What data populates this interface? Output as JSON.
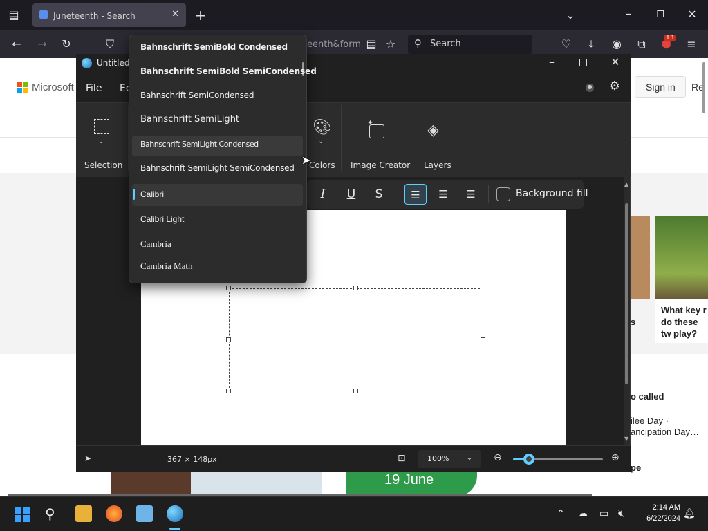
{
  "browser": {
    "tab_title": "Juneteenth - Search",
    "url_fragment": "eenth&form",
    "search_placeholder": "Search",
    "extension_badge": "13"
  },
  "webpage": {
    "brand": "Microsoft",
    "sign_in": "Sign in",
    "rewards_fragment": "Re",
    "card_question": "What key r do these tw play?",
    "also_called": "o called",
    "also_called_detail_1": "ilee Day ·",
    "also_called_detail_2": "ancipation Day…",
    "date_banner": "19 June",
    "partial_s": "s",
    "partial_pe": "pe"
  },
  "paint": {
    "window_title": "Untitled",
    "menu": {
      "file": "File",
      "edit_fragment": "Ec"
    },
    "toolbar": {
      "selection": "Selection",
      "colors": "Colors",
      "image_creator": "Image Creator",
      "layers": "Layers"
    },
    "format": {
      "background_fill": "Background fill"
    },
    "status": {
      "dimensions": "367 × 148px",
      "zoom": "100%"
    }
  },
  "font_list": {
    "items": [
      "Bahnschrift SemiBold Condensed",
      "Bahnschrift SemiBold SemiCondensed",
      "Bahnschrift SemiCondensed",
      "Bahnschrift SemiLight",
      "Bahnschrift SemiLight Condensed",
      "Bahnschrift SemiLight SemiCondensed",
      "Calibri",
      "Calibri Light",
      "Cambria",
      "Cambria Math"
    ],
    "selected": "Calibri"
  },
  "taskbar": {
    "time": "2:14 AM",
    "date": "6/22/2024"
  },
  "colors": {
    "accent": "#60cdff",
    "paint_bg": "#2b2b2b",
    "canvas": "#ffffff"
  }
}
